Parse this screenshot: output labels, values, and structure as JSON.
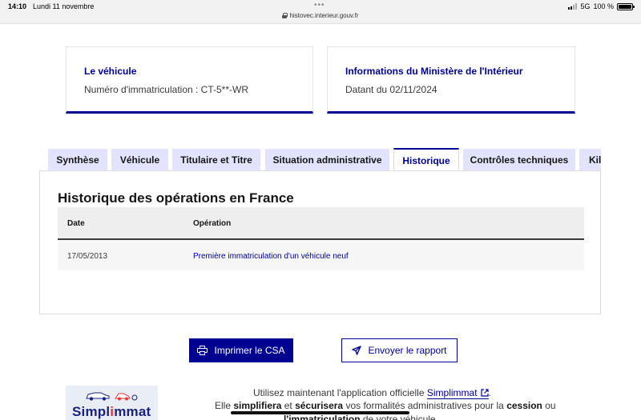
{
  "statusbar": {
    "time": "14:10",
    "date": "Lundi 11 novembre",
    "url": "histovec.interieur.gouv.fr",
    "network": "5G",
    "battery": "100 %",
    "battery_level": 1.0
  },
  "cards": {
    "vehicule": {
      "title": "Le véhicule",
      "text": "Numéro d'immatriculation : CT-5**-WR"
    },
    "ministere": {
      "title": "Informations du Ministère de l'Intérieur",
      "text": "Datant du 02/11/2024"
    }
  },
  "tabs": [
    {
      "label": "Synthèse",
      "active": false
    },
    {
      "label": "Véhicule",
      "active": false
    },
    {
      "label": "Titulaire et Titre",
      "active": false
    },
    {
      "label": "Situation administrative",
      "active": false
    },
    {
      "label": "Historique",
      "active": true
    },
    {
      "label": "Contrôles techniques",
      "active": false
    },
    {
      "label": "Kilo",
      "active": false
    }
  ],
  "panel": {
    "title": "Historique des opérations en France",
    "columns": [
      "Date",
      "Opération"
    ],
    "rows": [
      {
        "date": "17/05/2013",
        "operation": "Première immatriculation d'un véhicule neuf"
      }
    ]
  },
  "buttons": {
    "print": "Imprimer le CSA",
    "send": "Envoyer le rapport"
  },
  "promo": {
    "logo_text_main": "Simpl",
    "logo_text_accent": "i",
    "logo_text_end": "mmat",
    "line1_prefix": "Utilisez maintenant l'application officielle ",
    "line1_link": "Simplimmat",
    "line1_suffix": ".",
    "line2_elle": "Elle ",
    "line2_simplifiera": "simplifiera",
    "line2_et": " et ",
    "line2_securisera": "sécurisera",
    "line2_rest": " vos formalités administratives pour la ",
    "line2_cession": "cession",
    "line2_ou": " ou",
    "line3_immat": "l'immatriculation",
    "line3_rest": " de votre véhicule."
  },
  "colors": {
    "primary": "#000091",
    "tab_bg": "#e3e3fd"
  }
}
